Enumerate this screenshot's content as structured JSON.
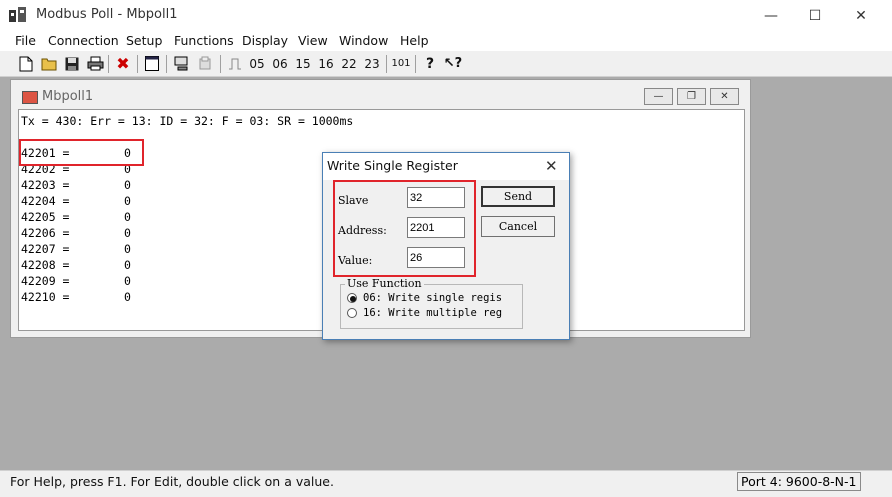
{
  "window": {
    "title": "Modbus Poll - Mbpoll1"
  },
  "menu": [
    "File",
    "Connection",
    "Setup",
    "Functions",
    "Display",
    "View",
    "Window",
    "Help"
  ],
  "toolbar": {
    "functions": [
      "05",
      "06",
      "15",
      "16",
      "22",
      "23"
    ],
    "display_code": "101"
  },
  "child": {
    "title": "Mbpoll1",
    "status": "Tx = 430: Err = 13: ID = 32: F = 03: SR = 1000ms",
    "registers": [
      {
        "addr": "42201 =",
        "value": "0"
      },
      {
        "addr": "42202 =",
        "value": "0"
      },
      {
        "addr": "42203 =",
        "value": "0"
      },
      {
        "addr": "42204 =",
        "value": "0"
      },
      {
        "addr": "42205 =",
        "value": "0"
      },
      {
        "addr": "42206 =",
        "value": "0"
      },
      {
        "addr": "42207 =",
        "value": "0"
      },
      {
        "addr": "42208 =",
        "value": "0"
      },
      {
        "addr": "42209 =",
        "value": "0"
      },
      {
        "addr": "42210 =",
        "value": "0"
      }
    ]
  },
  "dialog": {
    "title": "Write Single Register",
    "slave_label": "Slave",
    "slave_value": "32",
    "address_label": "Address:",
    "address_value": "2201",
    "value_label": "Value:",
    "value_value": "26",
    "send_label": "Send",
    "cancel_label": "Cancel",
    "group_title": "Use Function",
    "options": [
      "06: Write single regis",
      "16: Write multiple reg"
    ],
    "selected_option": 0
  },
  "statusbar": {
    "help_text": "For Help, press F1.  For Edit, double click on a value.",
    "port": "Port 4: 9600-8-N-1"
  },
  "colors": {
    "highlight": "#e0242b",
    "dialog_border": "#4a7fb5"
  }
}
